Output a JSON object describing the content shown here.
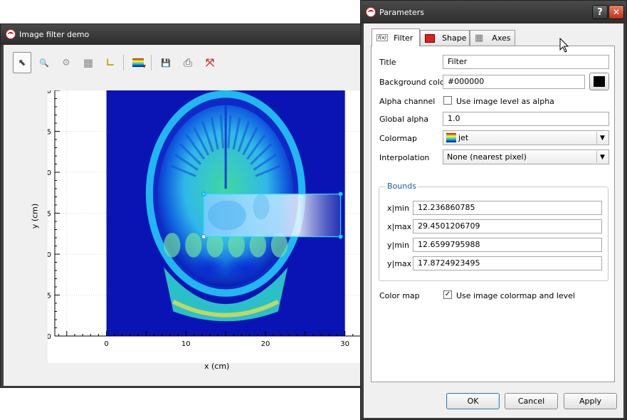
{
  "main_window": {
    "title": "Image filter demo",
    "toolbar": [
      {
        "name": "select-tool",
        "icon": "arrow-cursor-icon",
        "glyph": "⬉"
      },
      {
        "name": "zoom-tool",
        "icon": "magnifier-icon",
        "glyph": "🔍"
      },
      {
        "name": "settings-tool",
        "icon": "gear-icon",
        "glyph": "⚙"
      },
      {
        "name": "grid-tool",
        "icon": "grid-icon",
        "glyph": "▦"
      },
      {
        "name": "axes-tool",
        "icon": "axes-icon",
        "glyph": "∟"
      },
      {
        "name": "colormap-tool",
        "icon": "colormap-icon",
        "glyph": ""
      },
      {
        "name": "save-tool",
        "icon": "floppy-disk-icon",
        "glyph": "💾"
      },
      {
        "name": "print-tool",
        "icon": "printer-icon",
        "glyph": "⎙"
      },
      {
        "name": "fullscreen-tool",
        "icon": "expand-arrows-icon",
        "glyph": "⤧"
      }
    ],
    "plot": {
      "xlabel": "x (cm)",
      "ylabel": "y (cm)",
      "xticks": [
        "0",
        "10",
        "20",
        "30"
      ],
      "yticks": [
        "0",
        "5",
        "10",
        "15",
        "20",
        "25",
        "30"
      ],
      "xlim": [
        -6.5,
        32
      ],
      "ylim": [
        0,
        30
      ]
    }
  },
  "dialog": {
    "title": "Parameters",
    "help_glyph": "?",
    "close_glyph": "✕",
    "tabs": [
      {
        "label": "Filter",
        "icon": "function-icon"
      },
      {
        "label": "Shape",
        "icon": "shape-icon"
      },
      {
        "label": "Axes",
        "icon": "grid-icon"
      }
    ],
    "labels": {
      "title": "Title",
      "background_color": "Background color",
      "alpha_channel": "Alpha channel",
      "global_alpha": "Global alpha",
      "colormap": "Colormap",
      "interpolation": "Interpolation",
      "bounds": "Bounds",
      "xmin": "x|min",
      "xmax": "x|max",
      "ymin": "y|min",
      "ymax": "y|max",
      "color_map": "Color map"
    },
    "values": {
      "title": "Filter",
      "background_color": "#000000",
      "alpha_checkbox_label": "Use image level as alpha",
      "alpha_checked": false,
      "global_alpha": "1.0",
      "colormap": "jet",
      "interpolation": "None (nearest pixel)",
      "xmin": "12.236860785",
      "xmax": "29.4501206709",
      "ymin": "12.6599795988",
      "ymax": "17.8724923495",
      "color_map_checkbox_label": "Use image colormap and level",
      "color_map_checked": true
    },
    "buttons": {
      "ok": "OK",
      "cancel": "Cancel",
      "apply": "Apply"
    }
  },
  "chart_data": {
    "type": "heatmap",
    "xlabel": "x (cm)",
    "ylabel": "y (cm)",
    "xlim": [
      -6.5,
      32
    ],
    "ylim": [
      0,
      30
    ],
    "image_extent": {
      "x": [
        0,
        30
      ],
      "y": [
        0,
        30
      ]
    },
    "colormap": "jet",
    "filter_region": {
      "x": [
        12.24,
        29.45
      ],
      "y": [
        12.66,
        17.87
      ]
    }
  }
}
